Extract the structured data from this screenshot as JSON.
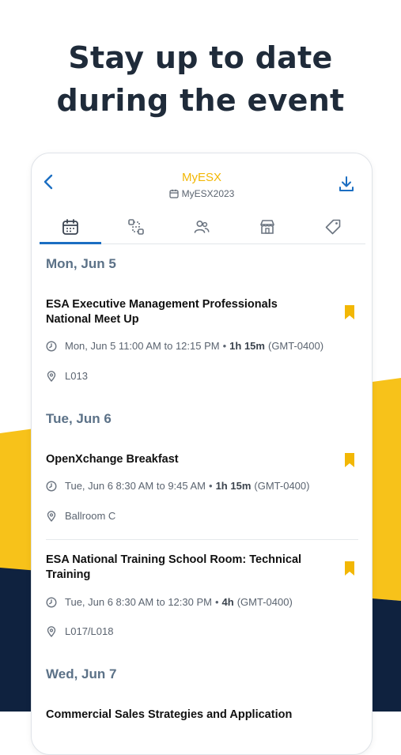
{
  "headline": {
    "line1": "Stay up to date",
    "line2": "during the event"
  },
  "colors": {
    "accent_yellow": "#F7C21A",
    "navy": "#0F223F",
    "blue": "#1B6EC2",
    "bookmark": "#F2B705"
  },
  "app": {
    "title": "MyESX",
    "subtitle": "MyESX2023"
  },
  "tabs": [
    {
      "icon": "calendar-icon",
      "active": true
    },
    {
      "icon": "schedule-path-icon",
      "active": false
    },
    {
      "icon": "people-icon",
      "active": false
    },
    {
      "icon": "store-icon",
      "active": false
    },
    {
      "icon": "tag-icon",
      "active": false
    }
  ],
  "schedule": {
    "days": [
      {
        "label": "Mon, Jun 5",
        "events": [
          {
            "title": "ESA Executive Management Professionals National Meet Up",
            "time": "Mon, Jun 5 11:00 AM to 12:15 PM",
            "sep": "•",
            "duration": "1h 15m",
            "tz": "(GMT-0400)",
            "location": "L013"
          }
        ]
      },
      {
        "label": "Tue, Jun 6",
        "events": [
          {
            "title": "OpenXchange Breakfast",
            "time": "Tue, Jun 6 8:30 AM to 9:45 AM",
            "sep": "•",
            "duration": "1h 15m",
            "tz": "(GMT-0400)",
            "location": "Ballroom C"
          },
          {
            "title": "ESA National Training School Room: Technical Training",
            "time": "Tue, Jun 6 8:30 AM to 12:30 PM",
            "sep": "•",
            "duration": "4h",
            "tz": "(GMT-0400)",
            "location": "L017/L018"
          }
        ]
      },
      {
        "label": "Wed, Jun 7",
        "events": [
          {
            "title": "Commercial Sales Strategies and Application"
          }
        ]
      }
    ]
  }
}
